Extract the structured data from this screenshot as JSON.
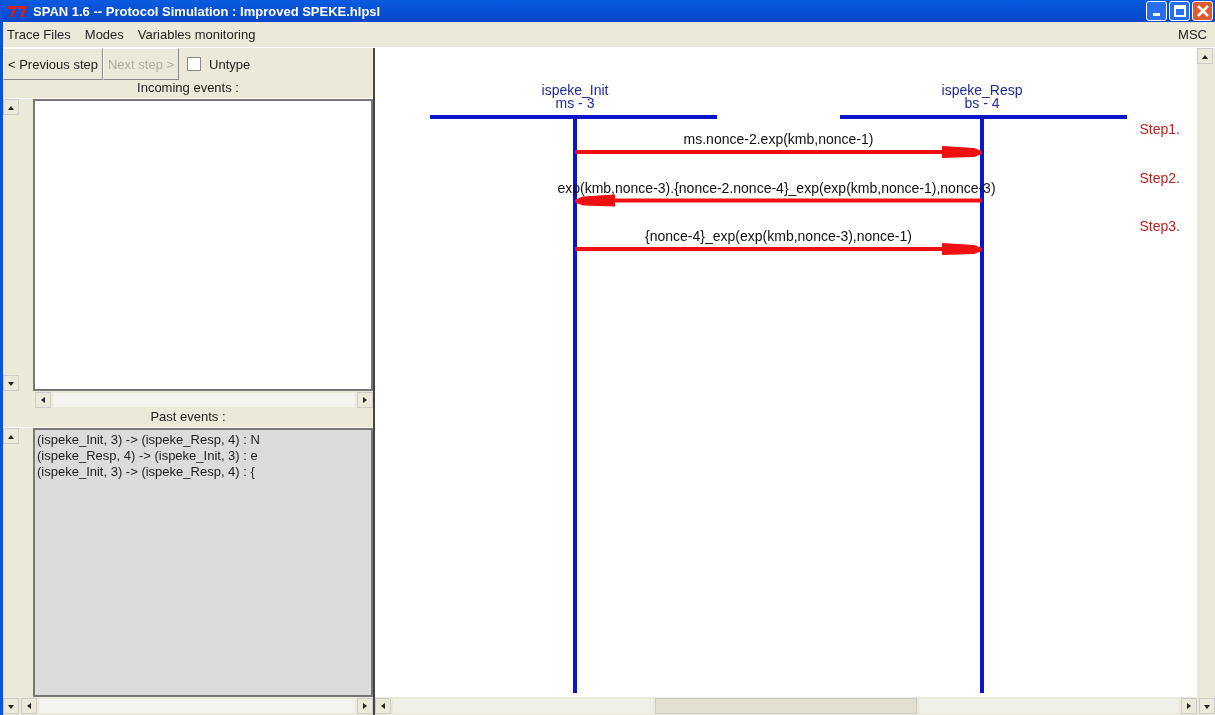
{
  "window": {
    "title": "SPAN 1.6 -- Protocol Simulation : Improved SPEKE.hlpsl"
  },
  "menu": [
    "Trace Files",
    "Modes",
    "Variables monitoring"
  ],
  "menu_right": "MSC",
  "toolbar": {
    "buttons": [
      {
        "label": "< Previous step",
        "disabled": false
      },
      {
        "label": "Next step >",
        "disabled": true
      }
    ],
    "checkbox": {
      "label": "Untype",
      "checked": false
    }
  },
  "incoming": {
    "title": "Incoming events :"
  },
  "past": {
    "title": "Past events :",
    "items": [
      "(ispeke_Init, 3) -> (ispeke_Resp, 4) : N",
      "(ispeke_Resp, 4) -> (ispeke_Init, 3) : e",
      "(ispeke_Init, 3) -> (ispeke_Resp, 4) : {"
    ]
  },
  "msc": {
    "instances": [
      {
        "name": "ispeke_Init",
        "id": "ms - 3"
      },
      {
        "name": "ispeke_Resp",
        "id": "bs - 4"
      }
    ],
    "messages": [
      {
        "label": "ms.nonce-2.exp(kmb,nonce-1)",
        "kind": "rightward"
      },
      {
        "label": "exp(kmb,nonce-3).{nonce-2.nonce-4}_exp(exp(kmb,nonce-1),nonce-3)",
        "kind": "leftward"
      },
      {
        "label": "{nonce-4}_exp(exp(kmb,nonce-3),nonce-1)",
        "kind": "rightward"
      }
    ],
    "steps": [
      "Step1.",
      "Step2.",
      "Step3."
    ]
  }
}
